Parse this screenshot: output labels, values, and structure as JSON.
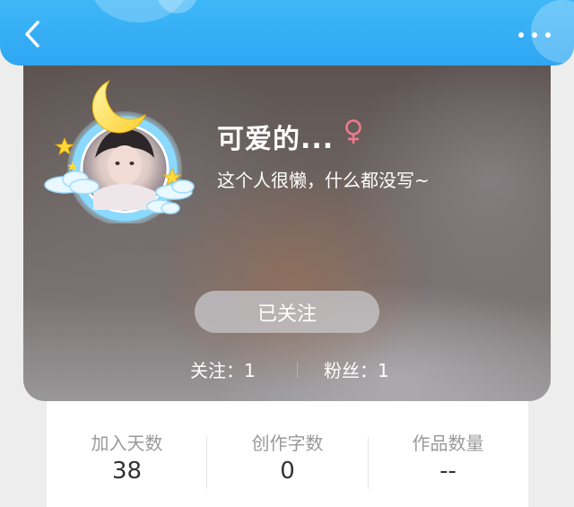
{
  "header": {
    "back_icon": "chevron-left-icon",
    "more_icon": "more-horizontal-icon",
    "accent_color": "#35aef4"
  },
  "profile": {
    "nickname": "可爱的...",
    "gender_symbol": "♀",
    "gender_color": "#f07a8c",
    "bio": "这个人很懒，什么都没写~",
    "follow_button_label": "已关注",
    "following_text": "关注：1",
    "followers_text": "粉丝：1"
  },
  "stats": [
    {
      "label": "加入天数",
      "value": "38"
    },
    {
      "label": "创作字数",
      "value": "0"
    },
    {
      "label": "作品数量",
      "value": "--"
    }
  ]
}
